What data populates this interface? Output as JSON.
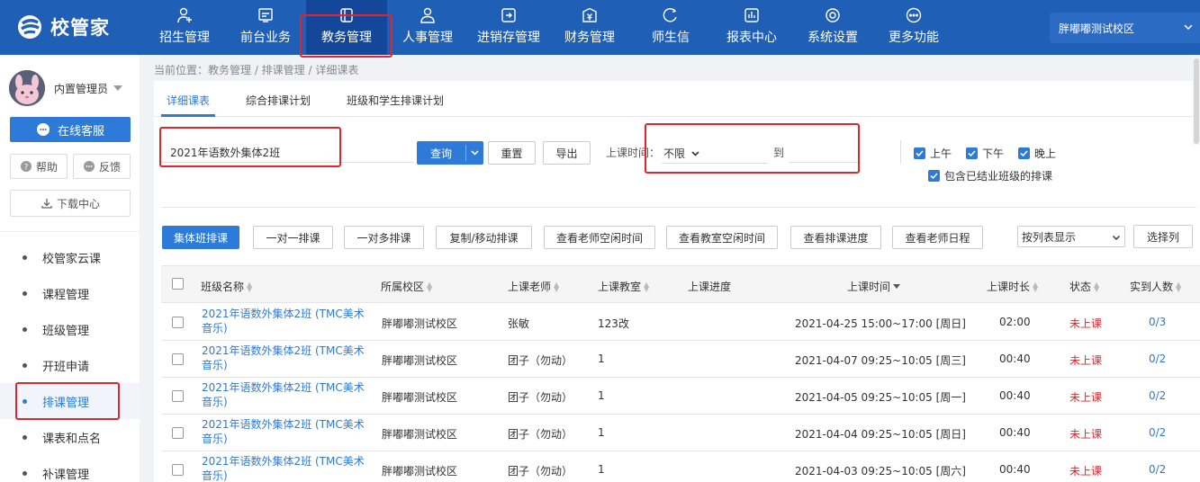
{
  "app": {
    "name": "校管家"
  },
  "nav": [
    {
      "label": "招生管理",
      "icon": "person-add-icon"
    },
    {
      "label": "前台业务",
      "icon": "monitor-icon"
    },
    {
      "label": "教务管理",
      "icon": "book-icon",
      "active": true
    },
    {
      "label": "人事管理",
      "icon": "person-icon"
    },
    {
      "label": "进销存管理",
      "icon": "inventory-icon"
    },
    {
      "label": "财务管理",
      "icon": "finance-icon"
    },
    {
      "label": "师生信",
      "icon": "chat-icon"
    },
    {
      "label": "报表中心",
      "icon": "chart-icon"
    },
    {
      "label": "系统设置",
      "icon": "gear-icon"
    },
    {
      "label": "更多功能",
      "icon": "more-icon"
    }
  ],
  "campus": "胖嘟嘟测试校区",
  "sidebar": {
    "user": "内置管理员",
    "service": "在线客服",
    "help": "帮助",
    "feedback": "反馈",
    "download": "下载中心",
    "menu": [
      "校管家云课",
      "课程管理",
      "班级管理",
      "开班申请",
      "排课管理",
      "课表和点名",
      "补课管理"
    ],
    "active_index": 4
  },
  "breadcrumb": "当前位置：教务管理 / 排课管理 / 详细课表",
  "tabs": [
    "详细课表",
    "综合排课计划",
    "班级和学生排课计划"
  ],
  "filter": {
    "search_value": "2021年语数外集体2班",
    "query": "查询",
    "reset": "重置",
    "export": "导出",
    "time_label": "上课时间：",
    "time_value": "不限",
    "to": "到",
    "morning": "上午",
    "afternoon": "下午",
    "evening": "晚上",
    "include_finished": "包含已结业班级的排课"
  },
  "actions": [
    "集体班排课",
    "一对一排课",
    "一对多排课",
    "复制/移动排课",
    "查看老师空闲时间",
    "查看教室空闲时间",
    "查看排课进度",
    "查看老师日程"
  ],
  "view_mode": "按列表显示",
  "select_columns": "选择列",
  "columns": [
    "班级名称",
    "所属校区",
    "上课老师",
    "上课教室",
    "上课进度",
    "上课时间",
    "上课时长",
    "状态",
    "实到人数"
  ],
  "rows": [
    {
      "name": "2021年语数外集体2班 (TMC美术音乐)",
      "campus": "胖嘟嘟测试校区",
      "teacher": "张敏",
      "room": "123改",
      "time": "2021-04-25 15:00~17:00 [周日]",
      "duration": "02:00",
      "status": "未上课",
      "count": "0/3"
    },
    {
      "name": "2021年语数外集体2班 (TMC美术音乐)",
      "campus": "胖嘟嘟测试校区",
      "teacher": "团子（勿动）",
      "room": "1",
      "time": "2021-04-07 09:25~10:05 [周三]",
      "duration": "00:40",
      "status": "未上课",
      "count": "0/2"
    },
    {
      "name": "2021年语数外集体2班 (TMC美术音乐)",
      "campus": "胖嘟嘟测试校区",
      "teacher": "团子（勿动）",
      "room": "1",
      "time": "2021-04-05 09:25~10:05 [周一]",
      "duration": "00:40",
      "status": "未上课",
      "count": "0/2"
    },
    {
      "name": "2021年语数外集体2班 (TMC美术音乐)",
      "campus": "胖嘟嘟测试校区",
      "teacher": "团子（勿动）",
      "room": "1",
      "time": "2021-04-04 09:25~10:05 [周日]",
      "duration": "00:40",
      "status": "未上课",
      "count": "0/2"
    },
    {
      "name": "2021年语数外集体2班 (TMC美术音乐)",
      "campus": "胖嘟嘟测试校区",
      "teacher": "团子（勿动）",
      "room": "1",
      "time": "2021-04-03 09:25~10:05 [周六]",
      "duration": "00:40",
      "status": "未上课",
      "count": "0/2"
    }
  ],
  "colors": {
    "topbar": "#1f5fb6",
    "accent": "#2e7ad9",
    "highlight": "#e0262c"
  }
}
